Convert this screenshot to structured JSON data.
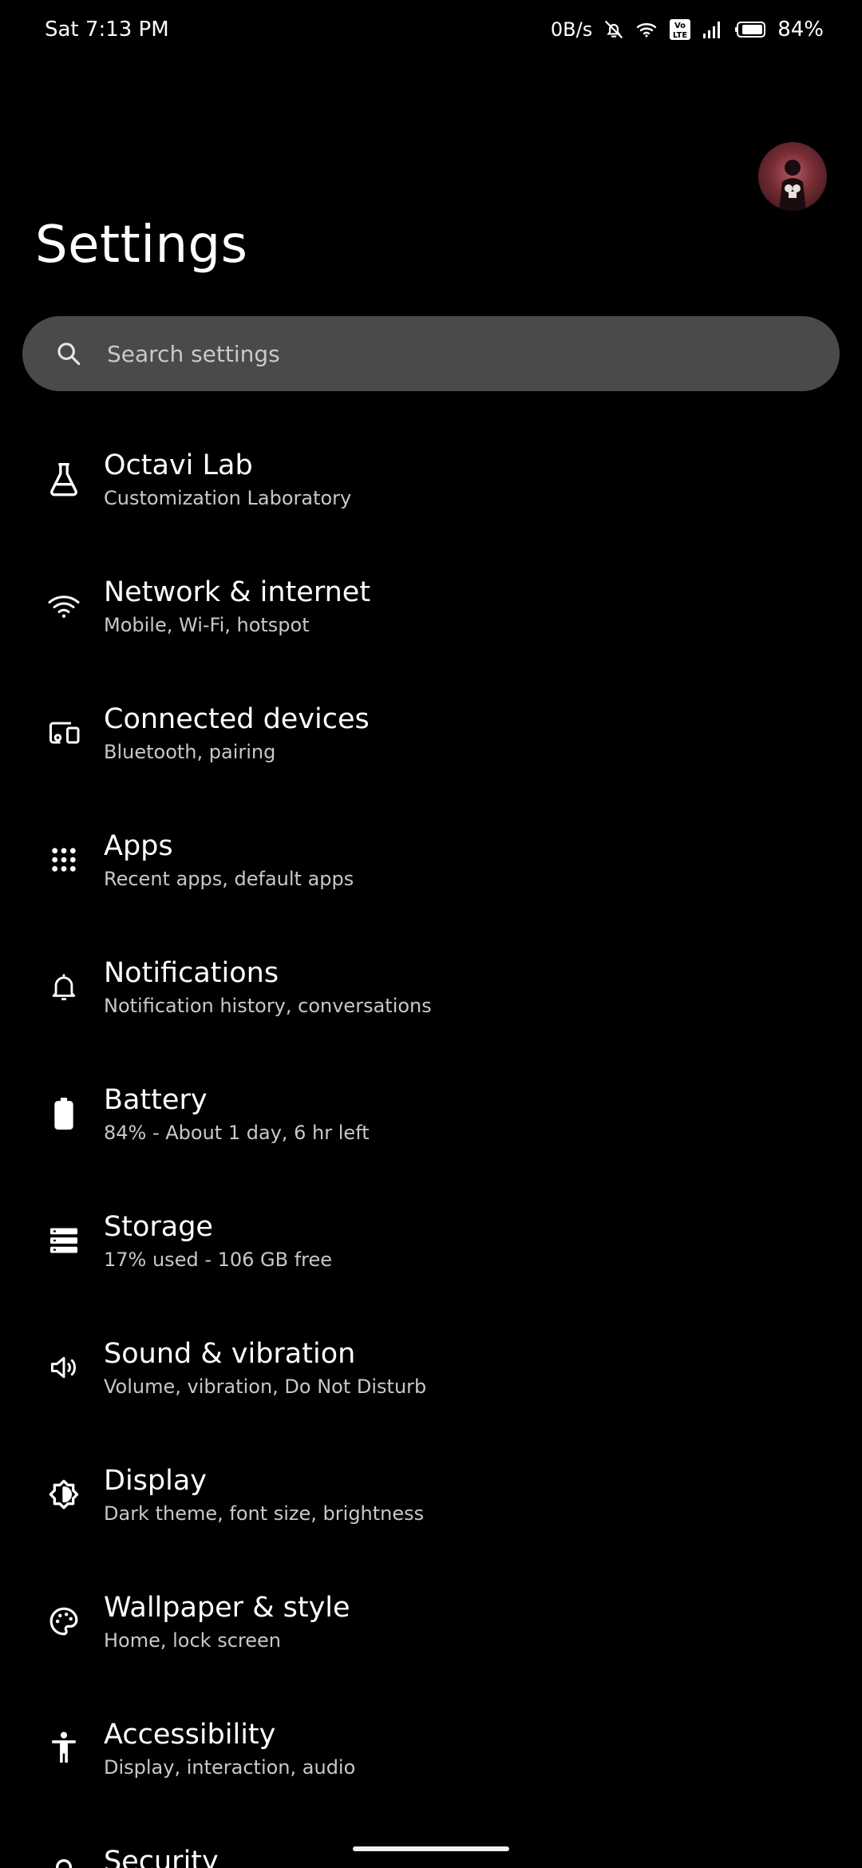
{
  "status_bar": {
    "time": "Sat 7:13 PM",
    "net_speed": "0B/s",
    "battery": "84%"
  },
  "header": {
    "title": "Settings"
  },
  "search": {
    "placeholder": "Search settings"
  },
  "items": [
    {
      "title": "Octavi Lab",
      "subtitle": "Customization Laboratory",
      "icon": "flask-icon"
    },
    {
      "title": "Network & internet",
      "subtitle": "Mobile, Wi-Fi, hotspot",
      "icon": "wifi-icon"
    },
    {
      "title": "Connected devices",
      "subtitle": "Bluetooth, pairing",
      "icon": "devices-icon"
    },
    {
      "title": "Apps",
      "subtitle": "Recent apps, default apps",
      "icon": "apps-grid-icon"
    },
    {
      "title": "Notifications",
      "subtitle": "Notification history, conversations",
      "icon": "bell-icon"
    },
    {
      "title": "Battery",
      "subtitle": "84% - About 1 day, 6 hr left",
      "icon": "battery-icon"
    },
    {
      "title": "Storage",
      "subtitle": "17% used - 106 GB free",
      "icon": "storage-icon"
    },
    {
      "title": "Sound & vibration",
      "subtitle": "Volume, vibration, Do Not Disturb",
      "icon": "speaker-icon"
    },
    {
      "title": "Display",
      "subtitle": "Dark theme, font size, brightness",
      "icon": "brightness-icon"
    },
    {
      "title": "Wallpaper & style",
      "subtitle": "Home, lock screen",
      "icon": "palette-icon"
    },
    {
      "title": "Accessibility",
      "subtitle": "Display, interaction, audio",
      "icon": "accessibility-icon"
    },
    {
      "title": "Security",
      "subtitle": "",
      "icon": "lock-icon"
    }
  ]
}
